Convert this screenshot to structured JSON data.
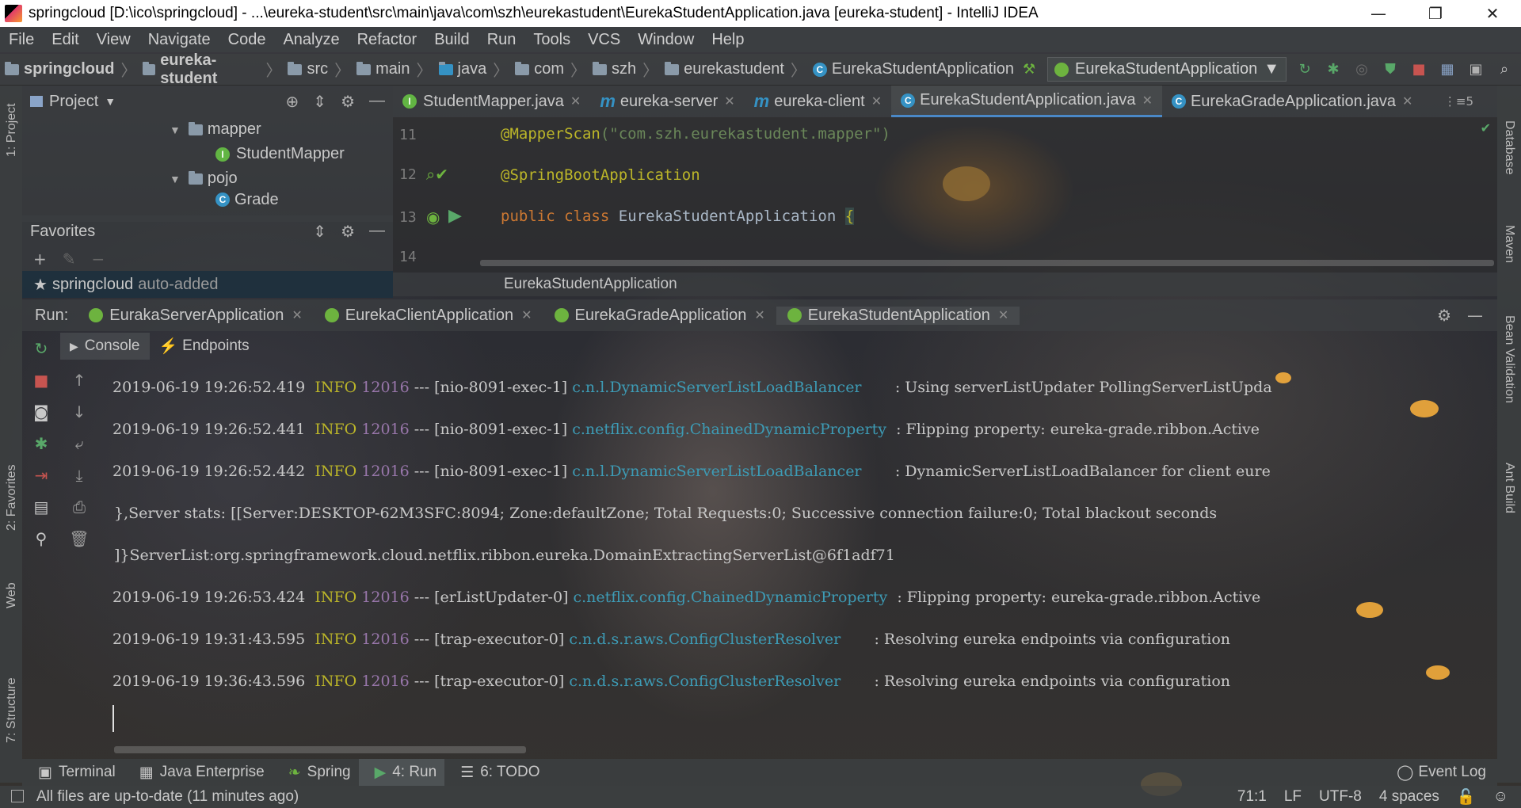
{
  "window": {
    "title": "springcloud [D:\\ico\\springcloud] - ...\\eureka-student\\src\\main\\java\\com\\szh\\eurekastudent\\EurekaStudentApplication.java [eureka-student] - IntelliJ IDEA",
    "minimize": "—",
    "maximize": "❐",
    "close": "✕"
  },
  "menu": [
    "File",
    "Edit",
    "View",
    "Navigate",
    "Code",
    "Analyze",
    "Refactor",
    "Build",
    "Run",
    "Tools",
    "VCS",
    "Window",
    "Help"
  ],
  "breadcrumb": [
    "springcloud",
    "eureka-student",
    "src",
    "main",
    "java",
    "com",
    "szh",
    "eurekastudent",
    "EurekaStudentApplication"
  ],
  "run_config": "EurekaStudentApplication",
  "left_stripe": [
    "1: Project",
    "2: Favorites",
    "Web",
    "7: Structure"
  ],
  "right_stripe": [
    "Database",
    "Maven",
    "Bean Validation",
    "Ant Build"
  ],
  "project_panel": {
    "title": "Project",
    "tree": [
      {
        "label": "mapper",
        "type": "folder",
        "expanded": true
      },
      {
        "label": "StudentMapper",
        "type": "interface"
      },
      {
        "label": "pojo",
        "type": "folder",
        "expanded": true
      },
      {
        "label": "Grade",
        "type": "class"
      }
    ]
  },
  "favorites_panel": {
    "title": "Favorites",
    "item": "springcloud",
    "item_note": "auto-added"
  },
  "editor_tabs": [
    {
      "label": "StudentMapper.java",
      "icon": "interface",
      "active": false
    },
    {
      "label": "eureka-server",
      "icon": "maven",
      "active": false
    },
    {
      "label": "eureka-client",
      "icon": "maven",
      "active": false
    },
    {
      "label": "EurekaStudentApplication.java",
      "icon": "spring-class",
      "active": true
    },
    {
      "label": "EurekaGradeApplication.java",
      "icon": "spring-class",
      "active": false
    }
  ],
  "editor_tabs_overflow": "5",
  "editor": {
    "lines": [
      {
        "no": "11",
        "annotation": "@MapperScan",
        "args": "(\"com.szh.eurekastudent.mapper\")"
      },
      {
        "no": "12",
        "annotation": "@SpringBootApplication"
      },
      {
        "no": "13",
        "keyword1": "public",
        "keyword2": "class",
        "name": "EurekaStudentApplication",
        "brace": "{"
      },
      {
        "no": "14"
      }
    ],
    "crumb": "EurekaStudentApplication"
  },
  "run_panel": {
    "label": "Run:",
    "tabs": [
      "EurakaServerApplication",
      "EurekaClientApplication",
      "EurekaGradeApplication",
      "EurekaStudentApplication"
    ],
    "subtabs": [
      "Console",
      "Endpoints"
    ]
  },
  "console": [
    {
      "ts": "2019-06-19 19:26:52.419",
      "level": "INFO",
      "pid": "12016",
      "sep": "---",
      "thread": "[nio-8091-exec-1]",
      "logger": "c.n.l.DynamicServerListLoadBalancer",
      "msg": ": Using serverListUpdater PollingServerListUpda"
    },
    {
      "ts": "2019-06-19 19:26:52.441",
      "level": "INFO",
      "pid": "12016",
      "sep": "---",
      "thread": "[nio-8091-exec-1]",
      "logger": "c.netflix.config.ChainedDynamicProperty",
      "msg": ": Flipping property: eureka-grade.ribbon.Active"
    },
    {
      "ts": "2019-06-19 19:26:52.442",
      "level": "INFO",
      "pid": "12016",
      "sep": "---",
      "thread": "[nio-8091-exec-1]",
      "logger": "c.n.l.DynamicServerListLoadBalancer",
      "msg": ": DynamicServerListLoadBalancer for client eure"
    },
    {
      "text": "},Server stats: [[Server:DESKTOP-62M3SFC:8094;  Zone:defaultZone;   Total Requests:0;  Successive connection failure:0;    Total blackout seconds"
    },
    {
      "text": "]}ServerList:org.springframework.cloud.netflix.ribbon.eureka.DomainExtractingServerList@6f1adf71"
    },
    {
      "ts": "2019-06-19 19:26:53.424",
      "level": "INFO",
      "pid": "12016",
      "sep": "---",
      "thread": "[erListUpdater-0]",
      "logger": "c.netflix.config.ChainedDynamicProperty",
      "msg": ": Flipping property: eureka-grade.ribbon.Active"
    },
    {
      "ts": "2019-06-19 19:31:43.595",
      "level": "INFO",
      "pid": "12016",
      "sep": "---",
      "thread": "[trap-executor-0]",
      "logger": "c.n.d.s.r.aws.ConfigClusterResolver",
      "msg": ": Resolving eureka endpoints via configuration"
    },
    {
      "ts": "2019-06-19 19:36:43.596",
      "level": "INFO",
      "pid": "12016",
      "sep": "---",
      "thread": "[trap-executor-0]",
      "logger": "c.n.d.s.r.aws.ConfigClusterResolver",
      "msg": ": Resolving eureka endpoints via configuration"
    }
  ],
  "bottom_tabs": [
    {
      "label": "Terminal",
      "active": false
    },
    {
      "label": "Java Enterprise",
      "active": false
    },
    {
      "label": "Spring",
      "active": false
    },
    {
      "label": "4: Run",
      "active": true
    },
    {
      "label": "6: TODO",
      "active": false
    }
  ],
  "event_log": "Event Log",
  "status": {
    "message": "All files are up-to-date (11 minutes ago)",
    "position": "71:1",
    "line_sep": "LF",
    "encoding": "UTF-8",
    "indent": "4 spaces"
  },
  "colors": {
    "accent": "#4a88c7",
    "annotation": "#bbb529",
    "keyword": "#cc7832",
    "logger": "#3d9bb5",
    "spring": "#6db33f"
  }
}
